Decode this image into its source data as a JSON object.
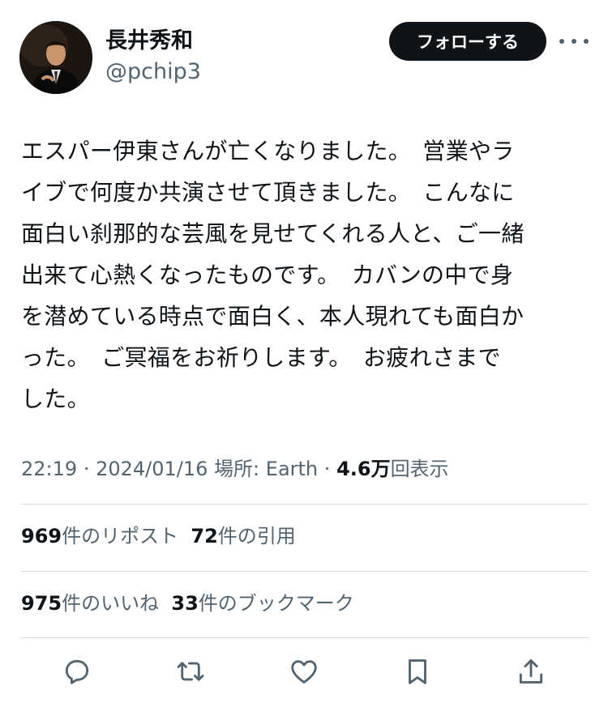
{
  "author": {
    "name": "長井秀和",
    "handle": "@pchip3"
  },
  "follow_label": "フォローする",
  "tweet": {
    "lines": [
      "エスパー伊東さんが亡くなりました。　営業やラ",
      "イブで何度か共演させて頂きました。　こんなに",
      "面白い刹那的な芸風を見せてくれる人と、ご一緒",
      "出来て心熱くなったものです。　カバンの中で身",
      "を潜めている時点で面白く、本人現れても面白か",
      "った。　ご冥福をお祈りします。　お疲れさまで",
      "した。"
    ]
  },
  "meta": {
    "time": "22:19",
    "date": "2024/01/16",
    "location": "場所: Earth",
    "views_count": "4.6万",
    "views_label": "回表示",
    "separator": "·"
  },
  "stats": {
    "reposts_count": "969",
    "reposts_label": "件のリポスト",
    "quotes_count": "72",
    "quotes_label": "件の引用",
    "likes_count": "975",
    "likes_label": "件のいいね",
    "bookmarks_count": "33",
    "bookmarks_label": "件のブックマーク"
  },
  "actions": [
    "reply-icon",
    "repost-icon",
    "like-icon",
    "bookmark-icon",
    "share-icon"
  ],
  "colors": {
    "text": "#0f1419",
    "secondary": "#536471",
    "divider": "#cfd9de",
    "button_bg": "#0f1419"
  }
}
